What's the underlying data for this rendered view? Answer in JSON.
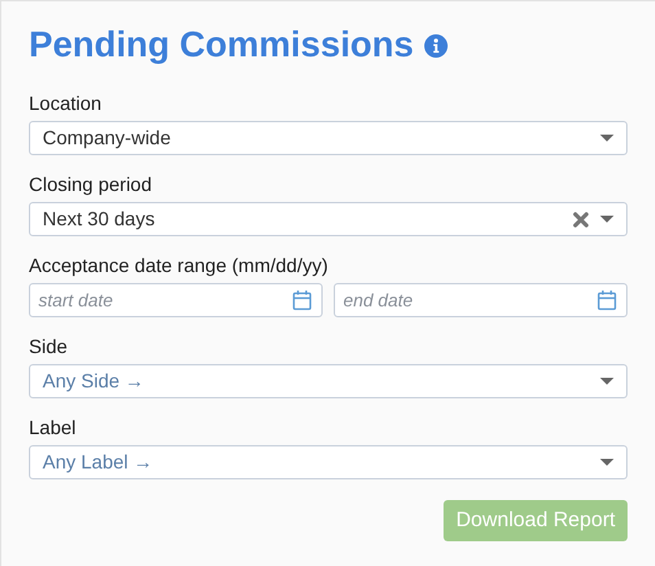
{
  "title": "Pending Commissions",
  "fields": [
    {
      "kind": "select",
      "label": "Location",
      "value": "Company-wide",
      "clearable": false
    },
    {
      "kind": "select",
      "label": "Closing period",
      "value": "Next 30 days",
      "clearable": true
    },
    {
      "kind": "daterange",
      "label": "Acceptance date range (mm/dd/yy)",
      "start_placeholder": "start date",
      "end_placeholder": "end date"
    },
    {
      "kind": "select",
      "label": "Side",
      "placeholder": "Any Side →",
      "clearable": false
    },
    {
      "kind": "select",
      "label": "Label",
      "placeholder": "Any Label →",
      "clearable": false
    }
  ],
  "download_button": {
    "label": "Download Report",
    "disabled": true
  }
}
